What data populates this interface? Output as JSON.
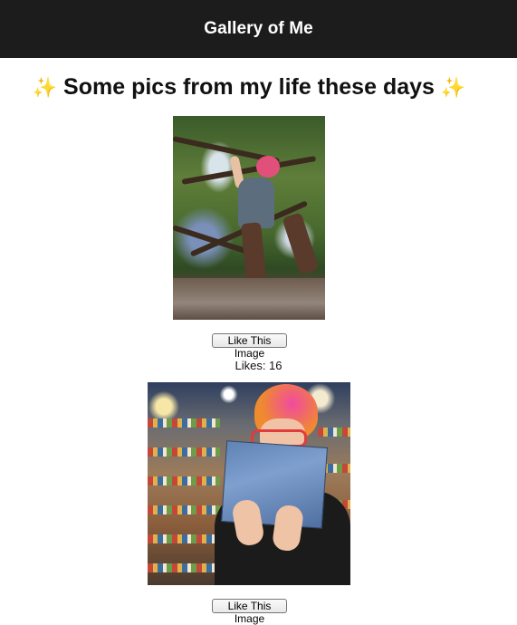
{
  "header": {
    "title": "Gallery of Me"
  },
  "main": {
    "heading_left_emoji": "✨",
    "heading_text": "Some pics from my life these days",
    "heading_right_emoji": "✨"
  },
  "gallery": [
    {
      "image_icon": "photo-person-in-tree",
      "like_button_label": "Like This Image",
      "likes_text": "Likes: 16"
    },
    {
      "image_icon": "photo-person-with-book-in-bookstore",
      "like_button_label": "Like This Image"
    }
  ]
}
